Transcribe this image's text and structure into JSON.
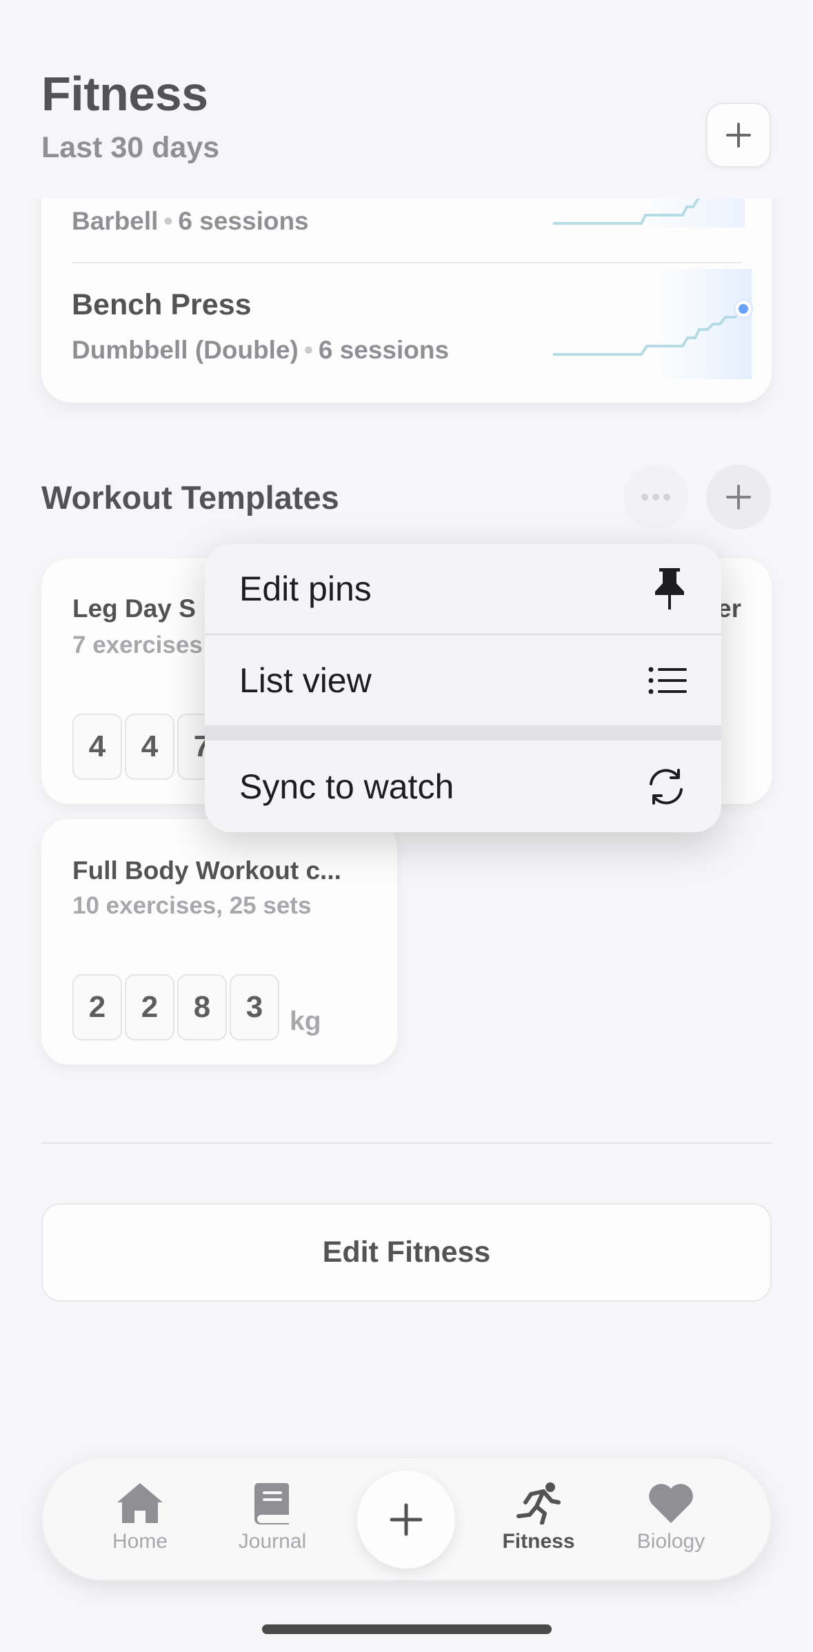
{
  "header": {
    "title": "Fitness",
    "subtitle": "Last 30 days",
    "add_icon": "plus-icon"
  },
  "exercises": [
    {
      "name": "",
      "equipment": "Barbell",
      "sessions": "6 sessions"
    },
    {
      "name": "Bench Press",
      "equipment": "Dumbbell (Double)",
      "sessions": "6 sessions"
    }
  ],
  "sparkline_color": "#9fd3df",
  "highlight_color": "#3a86ff",
  "templates_section": {
    "title": "Workout Templates",
    "more_icon": "ellipsis-icon",
    "add_icon": "plus-icon"
  },
  "templates": [
    {
      "name": "Leg Day S",
      "meta": "7 exercises",
      "digits": [
        "4",
        "4",
        "7"
      ]
    },
    {
      "name": "er",
      "meta": ""
    },
    {
      "name": "Full Body Workout c...",
      "meta": "10 exercises, 25 sets",
      "digits": [
        "2",
        "2",
        "8",
        "3"
      ],
      "unit": "kg"
    }
  ],
  "context_menu": {
    "items": [
      {
        "label": "Edit pins",
        "icon": "pin-icon"
      },
      {
        "label": "List view",
        "icon": "list-icon"
      },
      {
        "label": "Sync to watch",
        "icon": "sync-icon"
      }
    ]
  },
  "edit_button": {
    "label": "Edit Fitness"
  },
  "tab_bar": {
    "tabs": [
      {
        "label": "Home",
        "icon": "house-icon",
        "active": false
      },
      {
        "label": "Journal",
        "icon": "book-icon",
        "active": false
      },
      {
        "label": "Fitness",
        "icon": "runner-icon",
        "active": true
      },
      {
        "label": "Biology",
        "icon": "heart-icon",
        "active": false
      }
    ],
    "center_icon": "plus-icon"
  }
}
